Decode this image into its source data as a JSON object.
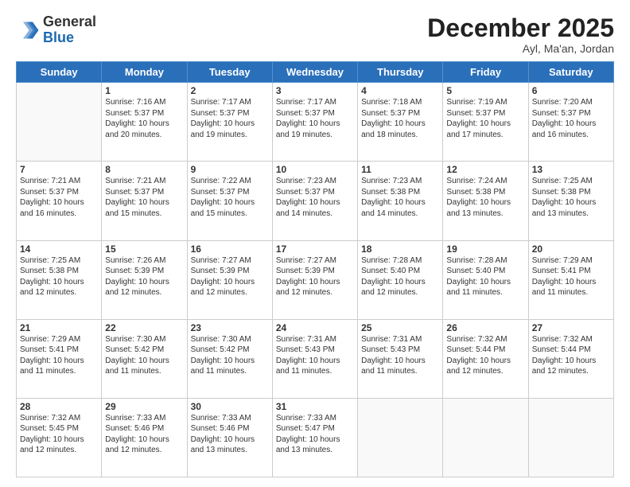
{
  "logo": {
    "general": "General",
    "blue": "Blue"
  },
  "title": "December 2025",
  "location": "Ayl, Ma'an, Jordan",
  "days_header": [
    "Sunday",
    "Monday",
    "Tuesday",
    "Wednesday",
    "Thursday",
    "Friday",
    "Saturday"
  ],
  "weeks": [
    [
      {
        "day": "",
        "info": ""
      },
      {
        "day": "1",
        "info": "Sunrise: 7:16 AM\nSunset: 5:37 PM\nDaylight: 10 hours\nand 20 minutes."
      },
      {
        "day": "2",
        "info": "Sunrise: 7:17 AM\nSunset: 5:37 PM\nDaylight: 10 hours\nand 19 minutes."
      },
      {
        "day": "3",
        "info": "Sunrise: 7:17 AM\nSunset: 5:37 PM\nDaylight: 10 hours\nand 19 minutes."
      },
      {
        "day": "4",
        "info": "Sunrise: 7:18 AM\nSunset: 5:37 PM\nDaylight: 10 hours\nand 18 minutes."
      },
      {
        "day": "5",
        "info": "Sunrise: 7:19 AM\nSunset: 5:37 PM\nDaylight: 10 hours\nand 17 minutes."
      },
      {
        "day": "6",
        "info": "Sunrise: 7:20 AM\nSunset: 5:37 PM\nDaylight: 10 hours\nand 16 minutes."
      }
    ],
    [
      {
        "day": "7",
        "info": "Sunrise: 7:21 AM\nSunset: 5:37 PM\nDaylight: 10 hours\nand 16 minutes."
      },
      {
        "day": "8",
        "info": "Sunrise: 7:21 AM\nSunset: 5:37 PM\nDaylight: 10 hours\nand 15 minutes."
      },
      {
        "day": "9",
        "info": "Sunrise: 7:22 AM\nSunset: 5:37 PM\nDaylight: 10 hours\nand 15 minutes."
      },
      {
        "day": "10",
        "info": "Sunrise: 7:23 AM\nSunset: 5:37 PM\nDaylight: 10 hours\nand 14 minutes."
      },
      {
        "day": "11",
        "info": "Sunrise: 7:23 AM\nSunset: 5:38 PM\nDaylight: 10 hours\nand 14 minutes."
      },
      {
        "day": "12",
        "info": "Sunrise: 7:24 AM\nSunset: 5:38 PM\nDaylight: 10 hours\nand 13 minutes."
      },
      {
        "day": "13",
        "info": "Sunrise: 7:25 AM\nSunset: 5:38 PM\nDaylight: 10 hours\nand 13 minutes."
      }
    ],
    [
      {
        "day": "14",
        "info": "Sunrise: 7:25 AM\nSunset: 5:38 PM\nDaylight: 10 hours\nand 12 minutes."
      },
      {
        "day": "15",
        "info": "Sunrise: 7:26 AM\nSunset: 5:39 PM\nDaylight: 10 hours\nand 12 minutes."
      },
      {
        "day": "16",
        "info": "Sunrise: 7:27 AM\nSunset: 5:39 PM\nDaylight: 10 hours\nand 12 minutes."
      },
      {
        "day": "17",
        "info": "Sunrise: 7:27 AM\nSunset: 5:39 PM\nDaylight: 10 hours\nand 12 minutes."
      },
      {
        "day": "18",
        "info": "Sunrise: 7:28 AM\nSunset: 5:40 PM\nDaylight: 10 hours\nand 12 minutes."
      },
      {
        "day": "19",
        "info": "Sunrise: 7:28 AM\nSunset: 5:40 PM\nDaylight: 10 hours\nand 11 minutes."
      },
      {
        "day": "20",
        "info": "Sunrise: 7:29 AM\nSunset: 5:41 PM\nDaylight: 10 hours\nand 11 minutes."
      }
    ],
    [
      {
        "day": "21",
        "info": "Sunrise: 7:29 AM\nSunset: 5:41 PM\nDaylight: 10 hours\nand 11 minutes."
      },
      {
        "day": "22",
        "info": "Sunrise: 7:30 AM\nSunset: 5:42 PM\nDaylight: 10 hours\nand 11 minutes."
      },
      {
        "day": "23",
        "info": "Sunrise: 7:30 AM\nSunset: 5:42 PM\nDaylight: 10 hours\nand 11 minutes."
      },
      {
        "day": "24",
        "info": "Sunrise: 7:31 AM\nSunset: 5:43 PM\nDaylight: 10 hours\nand 11 minutes."
      },
      {
        "day": "25",
        "info": "Sunrise: 7:31 AM\nSunset: 5:43 PM\nDaylight: 10 hours\nand 11 minutes."
      },
      {
        "day": "26",
        "info": "Sunrise: 7:32 AM\nSunset: 5:44 PM\nDaylight: 10 hours\nand 12 minutes."
      },
      {
        "day": "27",
        "info": "Sunrise: 7:32 AM\nSunset: 5:44 PM\nDaylight: 10 hours\nand 12 minutes."
      }
    ],
    [
      {
        "day": "28",
        "info": "Sunrise: 7:32 AM\nSunset: 5:45 PM\nDaylight: 10 hours\nand 12 minutes."
      },
      {
        "day": "29",
        "info": "Sunrise: 7:33 AM\nSunset: 5:46 PM\nDaylight: 10 hours\nand 12 minutes."
      },
      {
        "day": "30",
        "info": "Sunrise: 7:33 AM\nSunset: 5:46 PM\nDaylight: 10 hours\nand 13 minutes."
      },
      {
        "day": "31",
        "info": "Sunrise: 7:33 AM\nSunset: 5:47 PM\nDaylight: 10 hours\nand 13 minutes."
      },
      {
        "day": "",
        "info": ""
      },
      {
        "day": "",
        "info": ""
      },
      {
        "day": "",
        "info": ""
      }
    ]
  ]
}
